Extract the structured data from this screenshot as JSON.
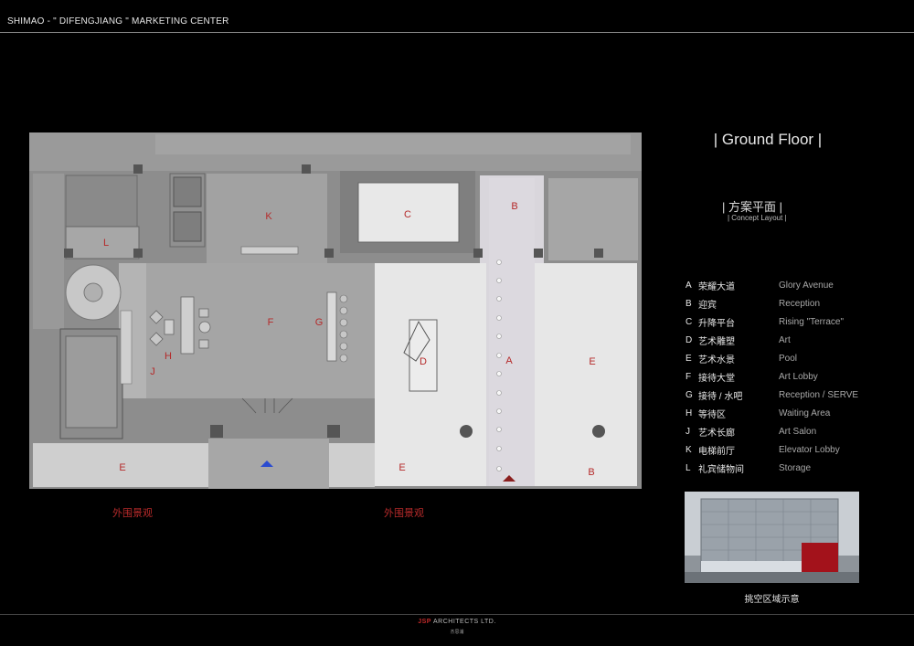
{
  "header": {
    "title": "SHIMAO - \" DIFENGJIANG \" MARKETING CENTER"
  },
  "panel": {
    "title": "| Ground Floor |",
    "subtitle_cn": "| 方案平面 |",
    "subtitle_en": "| Concept Layout |"
  },
  "legend": [
    {
      "key": "A",
      "cn": "荣耀大道",
      "en": "Glory Avenue"
    },
    {
      "key": "B",
      "cn": "迎宾",
      "en": "Reception"
    },
    {
      "key": "C",
      "cn": "升降平台",
      "en": "Rising \"Terrace\""
    },
    {
      "key": "D",
      "cn": "艺术雕塑",
      "en": "Art"
    },
    {
      "key": "E",
      "cn": "艺术水景",
      "en": "Pool"
    },
    {
      "key": "F",
      "cn": "接待大堂",
      "en": "Art Lobby"
    },
    {
      "key": "G",
      "cn": "接待 / 水吧",
      "en": "Reception / SERVE"
    },
    {
      "key": "H",
      "cn": "等待区",
      "en": "Waiting Area"
    },
    {
      "key": "J",
      "cn": "艺术长廊",
      "en": "Art Salon"
    },
    {
      "key": "K",
      "cn": "电梯前厅",
      "en": "Elevator Lobby"
    },
    {
      "key": "L",
      "cn": "礼宾储物间",
      "en": "Storage"
    }
  ],
  "plan": {
    "labels": [
      "K",
      "C",
      "B",
      "L",
      "F",
      "G",
      "H",
      "J",
      "D",
      "A",
      "E",
      "E",
      "E",
      "E",
      "B"
    ],
    "landscape_labels": [
      "外围景观",
      "外围景观"
    ],
    "colors": {
      "label_red": "#b52a2a",
      "arrow_blue": "#2a4bd0",
      "arrow_red": "#8a1f1f"
    }
  },
  "render": {
    "caption": "挑空区域示意"
  },
  "footer": {
    "brand_mark": "JSP",
    "brand_text": " ARCHITECTS LTD.",
    "brand_cn": "杰思浦"
  }
}
